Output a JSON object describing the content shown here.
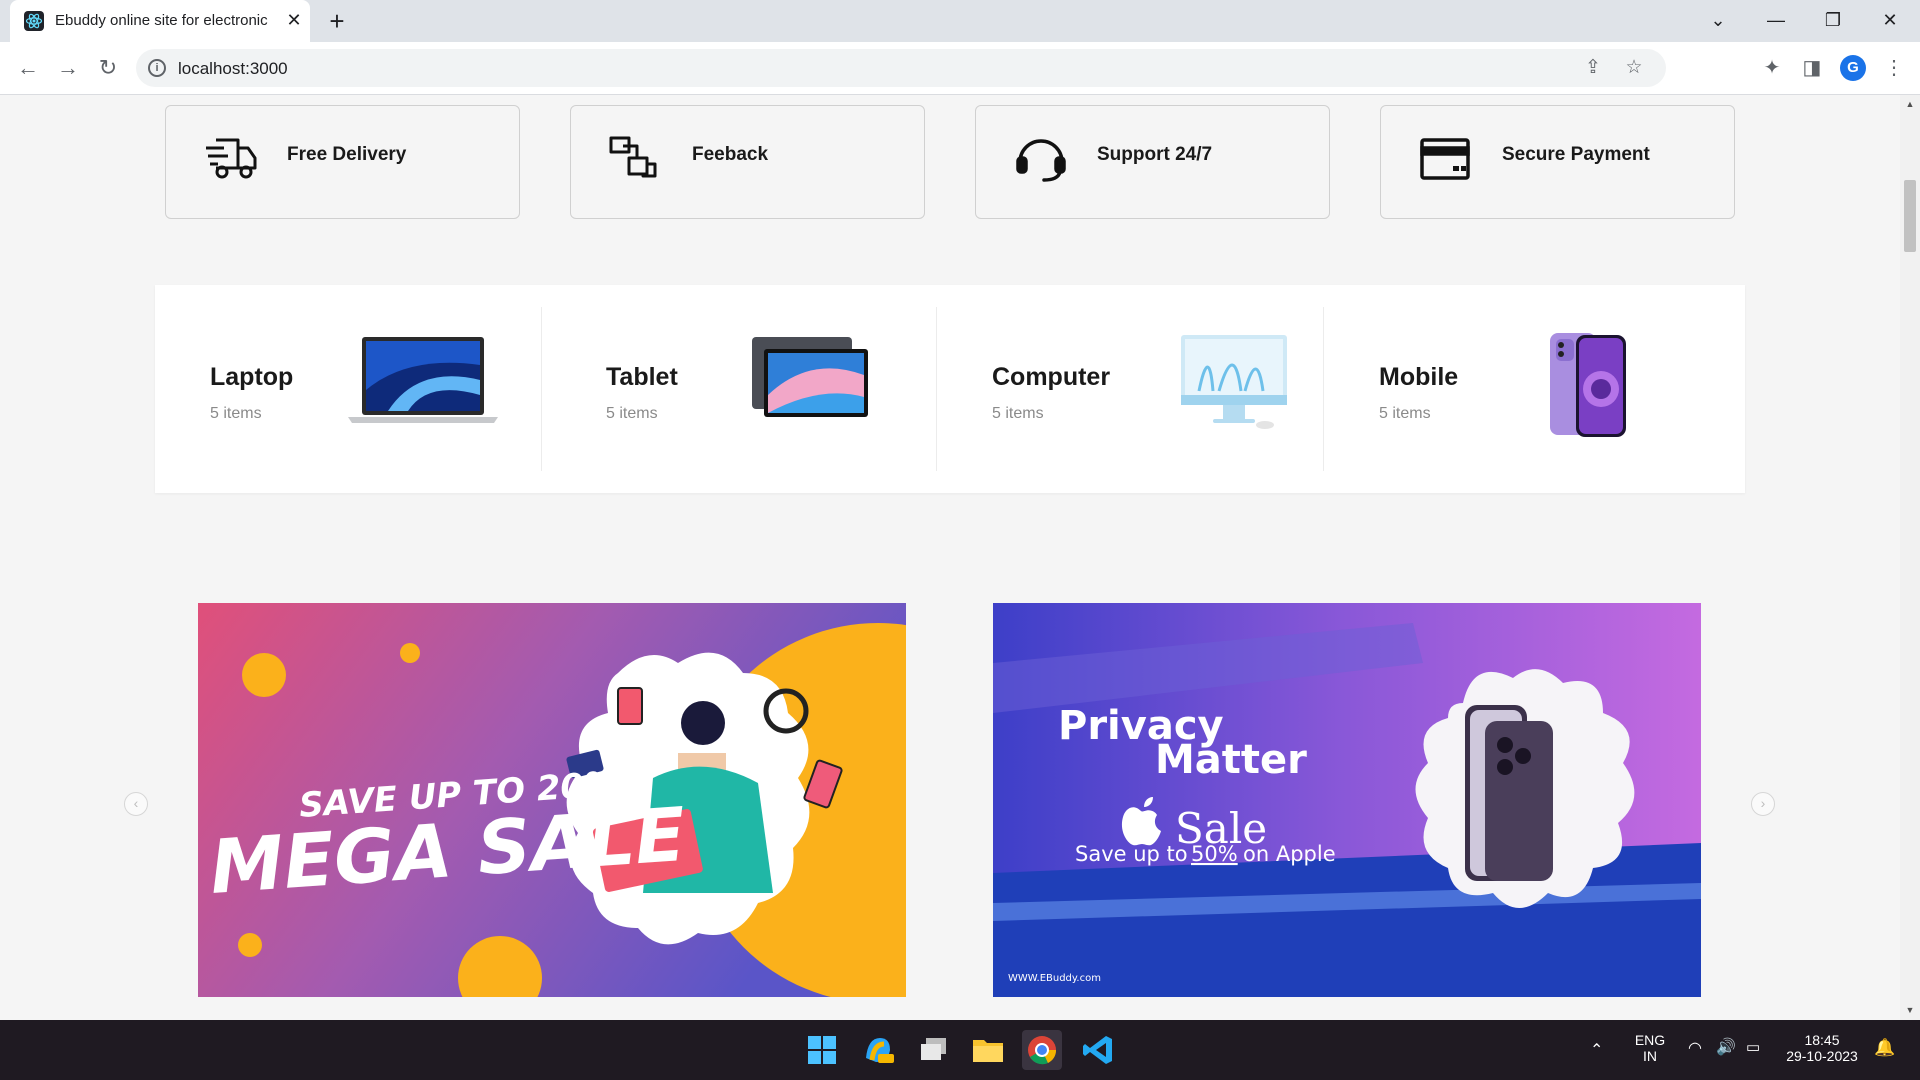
{
  "browser": {
    "tab_title": "Ebuddy online site for electronic",
    "url": "localhost:3000",
    "profile_initial": "G"
  },
  "features": [
    {
      "label": "Free Delivery",
      "icon": "truck-icon"
    },
    {
      "label": "Feeback",
      "icon": "feedback-icon"
    },
    {
      "label": "Support 24/7",
      "icon": "headset-icon"
    },
    {
      "label": "Secure Payment",
      "icon": "credit-card-icon"
    }
  ],
  "categories": [
    {
      "name": "Laptop",
      "count": "5 items",
      "icon": "laptop-image"
    },
    {
      "name": "Tablet",
      "count": "5 items",
      "icon": "tablet-image"
    },
    {
      "name": "Computer",
      "count": "5 items",
      "icon": "computer-image"
    },
    {
      "name": "Mobile",
      "count": "5 items",
      "icon": "mobile-image"
    }
  ],
  "banners": {
    "left": {
      "line1": "SAVE UP TO 20%",
      "line2": "MEGA SALE"
    },
    "right": {
      "line1": "Privacy",
      "line2": "Matter",
      "sale": "Sale",
      "tagline_pre": "Save up to",
      "tagline_pct": "50%",
      "tagline_post": "on Apple",
      "footer": "WWW.EBuddy.com"
    }
  },
  "taskbar": {
    "lang1": "ENG",
    "lang2": "IN",
    "time": "18:45",
    "date": "29-10-2023"
  },
  "colors": {
    "accent": "#1a73e8",
    "page_bg": "#f5f5f5",
    "taskbar_bg": "#1f1a22"
  }
}
